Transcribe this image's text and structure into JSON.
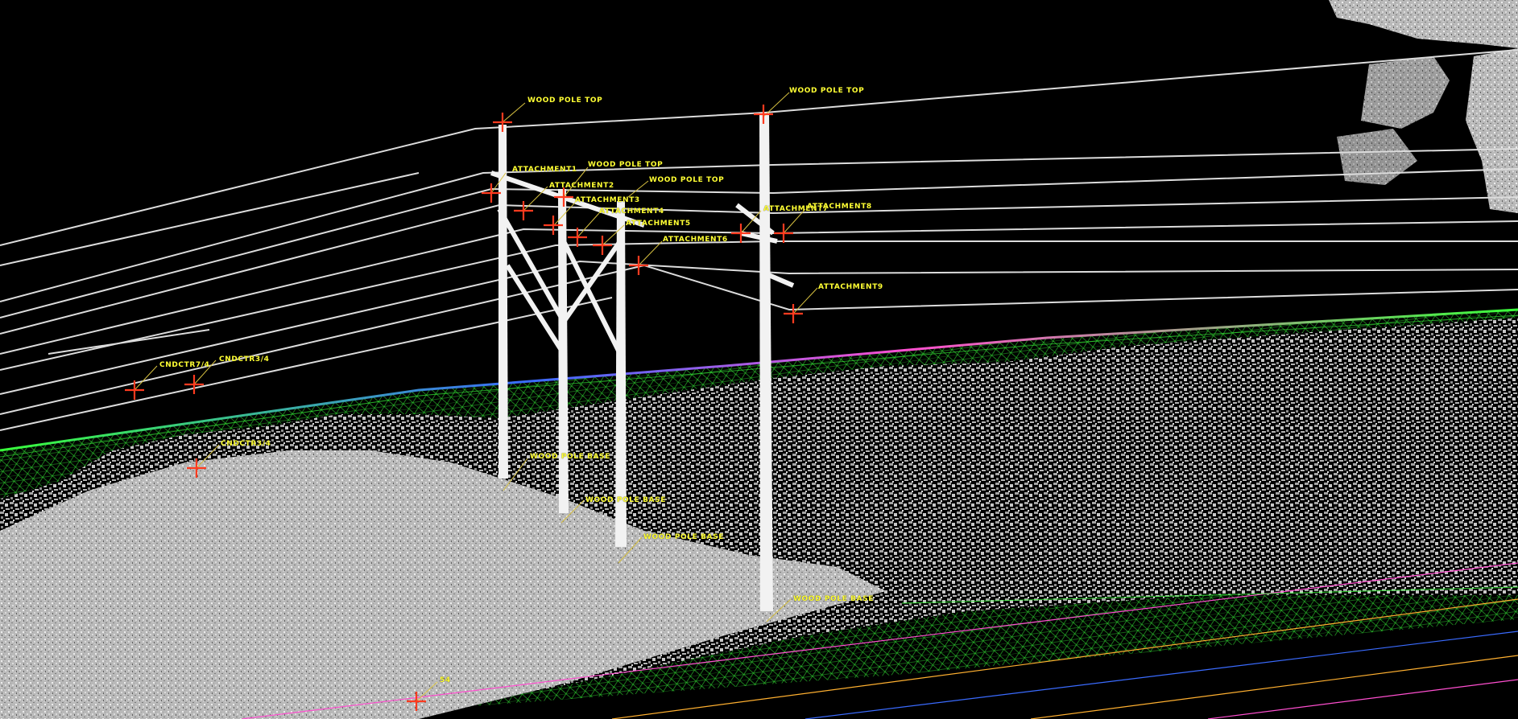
{
  "viewport": {
    "name": "lidar-point-cloud-view",
    "background": "#000000",
    "label_color": "#ffff33",
    "marker_color": "#ff3b1f",
    "leader_color": "#d6c040",
    "terrain_colors": [
      "#39ff3a",
      "#b0ff2a",
      "#ff4fd0",
      "#3a6bff",
      "#ffb030"
    ]
  },
  "features": [
    {
      "id": "pole1-top",
      "type": "wood-pole-top",
      "label": "WOOD POLE TOP"
    },
    {
      "id": "pole1-att1",
      "type": "attachment",
      "label": "ATTACHMENT1"
    },
    {
      "id": "pole2-top",
      "type": "wood-pole-top",
      "label": "WOOD POLE TOP"
    },
    {
      "id": "pole2-att2",
      "type": "attachment",
      "label": "ATTACHMENT2"
    },
    {
      "id": "pole3-top",
      "type": "wood-pole-top",
      "label": "WOOD POLE TOP"
    },
    {
      "id": "pole2-att3",
      "type": "attachment",
      "label": "ATTACHMENT3"
    },
    {
      "id": "pole2-att4",
      "type": "attachment",
      "label": "ATTACHMENT4"
    },
    {
      "id": "pole3-att5",
      "type": "attachment",
      "label": "ATTACHMENT5"
    },
    {
      "id": "pole3-att6",
      "type": "attachment",
      "label": "ATTACHMENT6"
    },
    {
      "id": "pole4-top",
      "type": "wood-pole-top",
      "label": "WOOD POLE TOP"
    },
    {
      "id": "pole4-att7",
      "type": "attachment",
      "label": "ATTACHMENT7"
    },
    {
      "id": "pole4-att8",
      "type": "attachment",
      "label": "ATTACHMENT8"
    },
    {
      "id": "pole4-att9",
      "type": "attachment",
      "label": "ATTACHMENT9"
    },
    {
      "id": "cndctr-a",
      "type": "conductor",
      "label": "CNDCTR7/4"
    },
    {
      "id": "cndctr-b",
      "type": "conductor",
      "label": "CNDCTR3/4"
    },
    {
      "id": "cndctr-c",
      "type": "conductor",
      "label": "CNDCTR3/4"
    },
    {
      "id": "pole1-base",
      "type": "wood-pole-base",
      "label": "WOOD POLE BASE"
    },
    {
      "id": "pole2-base",
      "type": "wood-pole-base",
      "label": "WOOD POLE BASE"
    },
    {
      "id": "pole3-base",
      "type": "wood-pole-base",
      "label": "WOOD POLE BASE"
    },
    {
      "id": "pole4-base",
      "type": "wood-pole-base",
      "label": "WOOD POLE BASE"
    },
    {
      "id": "ground-point",
      "type": "ground",
      "label": "54"
    }
  ]
}
